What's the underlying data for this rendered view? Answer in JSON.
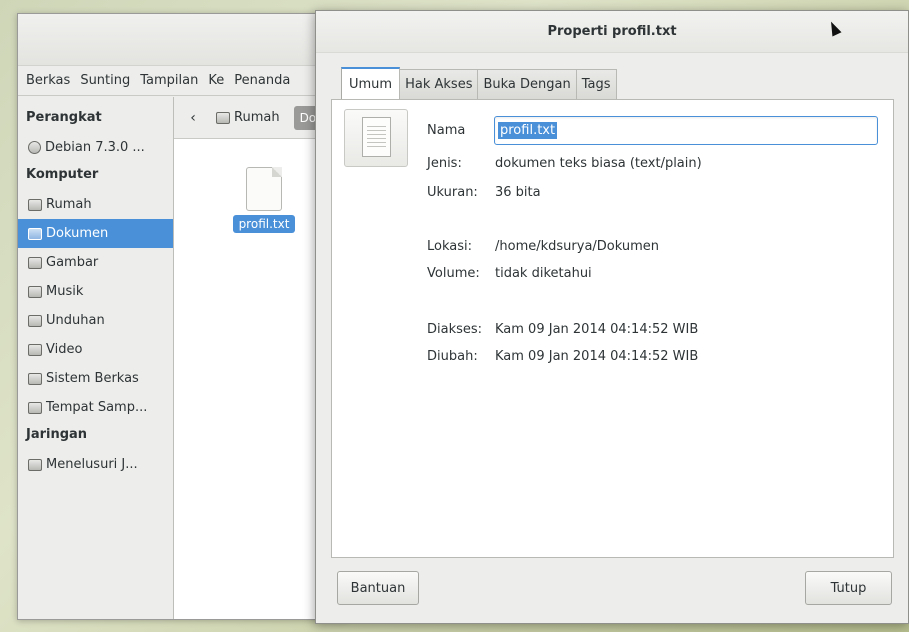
{
  "file_manager": {
    "menu": [
      "Berkas",
      "Sunting",
      "Tampilan",
      "Ke",
      "Penanda"
    ],
    "sidebar": {
      "sections": [
        {
          "heading": "Perangkat",
          "items": [
            {
              "label": "Debian 7.3.0 ...",
              "icon": "disc-icon"
            }
          ]
        },
        {
          "heading": "Komputer",
          "items": [
            {
              "label": "Rumah",
              "icon": "home-folder-icon"
            },
            {
              "label": "Dokumen",
              "icon": "documents-folder-icon",
              "selected": true
            },
            {
              "label": "Gambar",
              "icon": "pictures-folder-icon"
            },
            {
              "label": "Musik",
              "icon": "music-folder-icon"
            },
            {
              "label": "Unduhan",
              "icon": "downloads-folder-icon"
            },
            {
              "label": "Video",
              "icon": "videos-folder-icon"
            },
            {
              "label": "Sistem Berkas",
              "icon": "filesystem-icon"
            },
            {
              "label": "Tempat Samp...",
              "icon": "trash-icon"
            }
          ]
        },
        {
          "heading": "Jaringan",
          "items": [
            {
              "label": "Menelusuri J...",
              "icon": "network-icon"
            }
          ]
        }
      ]
    },
    "pathbar": {
      "crumbs": [
        "Rumah",
        "Do"
      ]
    },
    "file": {
      "label": "profil.txt"
    }
  },
  "dialog": {
    "title": "Properti profil.txt",
    "tabs": [
      "Umum",
      "Hak Akses",
      "Buka Dengan",
      "Tags"
    ],
    "name_label": "Nama",
    "name_value": "profil.txt",
    "type_label": "Jenis:",
    "type_value": "dokumen teks biasa (text/plain)",
    "size_label": "Ukuran:",
    "size_value": "36 bita",
    "location_label": "Lokasi:",
    "location_value": "/home/kdsurya/Dokumen",
    "volume_label": "Volume:",
    "volume_value": "tidak diketahui",
    "accessed_label": "Diakses:",
    "accessed_value": "Kam 09 Jan 2014 04:14:52  WIB",
    "modified_label": "Diubah:",
    "modified_value": "Kam 09 Jan 2014 04:14:52  WIB",
    "help_button": "Bantuan",
    "close_button": "Tutup"
  },
  "colors": {
    "accent": "#4a90d9"
  }
}
